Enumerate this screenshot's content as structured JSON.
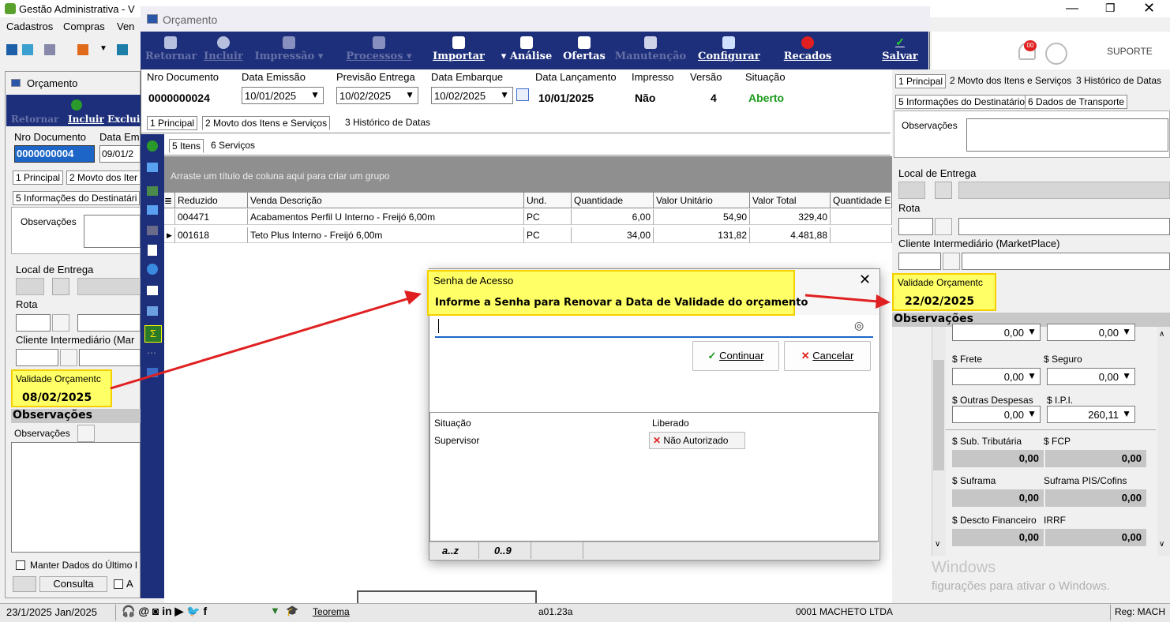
{
  "window": {
    "title": "Gestão Administrativa - V",
    "menu": [
      "Cadastros",
      "Compras",
      "Ven"
    ],
    "support_label": "SUPORTE",
    "notif_count": "00"
  },
  "left_panel": {
    "window_title": "Orçamento",
    "toolbar": {
      "retornar": "Retornar",
      "incluir": "Incluir",
      "excluir": "Exclui"
    },
    "nro_label": "Nro Documento",
    "data_label": "Data Em",
    "nro_value": "0000000004",
    "data_value": "09/01/2",
    "tabs": [
      "1 Principal",
      "2 Movto dos Iter"
    ],
    "tab2": "5 Informações do Destinatári",
    "observacoes_label": "Observações",
    "local_entrega": "Local de Entrega",
    "rota": "Rota",
    "cliente_intermediario": "Cliente Intermediário (Mar",
    "validade_label": "Validade Orçamentc",
    "validade_value": "08/02/2025",
    "observacoes_header": "Observações",
    "observacoes2_label": "Observações",
    "manter_dados": "Manter Dados do Último I",
    "consulta": "Consulta",
    "a_label": "A"
  },
  "inner": {
    "window_title": "Orçamento",
    "toolbar": {
      "retornar": "Retornar",
      "incluir": "Incluir",
      "impressao": "Impressão",
      "processos": "Processos",
      "importar": "Importar",
      "analise": "Análise",
      "ofertas": "Ofertas",
      "manutencao": "Manutenção",
      "configurar": "Configurar",
      "recados": "Recados",
      "salvar": "Salvar"
    },
    "header": {
      "nro_label": "Nro Documento",
      "nro_value": "0000000024",
      "emissao_label": "Data Emissão",
      "emissao_value": "10/01/2025",
      "previsao_label": "Previsão Entrega",
      "previsao_value": "10/02/2025",
      "embarque_label": "Data Embarque",
      "embarque_value": "10/02/2025",
      "lancamento_label": "Data Lançamento",
      "lancamento_value": "10/01/2025",
      "impresso_label": "Impresso",
      "impresso_value": "Não",
      "versao_label": "Versão",
      "versao_value": "4",
      "situacao_label": "Situação",
      "situacao_value": "Aberto"
    },
    "tabs": [
      "1 Principal",
      "2 Movto dos Itens e Serviços",
      "3 Histórico de Datas"
    ],
    "subtabs": [
      "5 Itens",
      "6 Serviços"
    ],
    "group_hint": "Arraste um título de coluna aqui para criar um grupo",
    "columns": [
      "Reduzido",
      "Venda Descrição",
      "Und.",
      "Quantidade",
      "Valor Unitário",
      "Valor Total",
      "Quantidade E"
    ],
    "rows": [
      [
        "004471",
        "Acabamentos Perfil U Interno - Freijó 6,00m",
        "PC",
        "6,00",
        "54,90",
        "329,40"
      ],
      [
        "001618",
        "Teto Plus Interno - Freijó 6,00m",
        "PC",
        "34,00",
        "131,82",
        "4.481,88"
      ]
    ]
  },
  "dialog": {
    "title": "Senha de Acesso",
    "subtitle": "Informe a Senha para Renovar a Data de Validade do orçamento",
    "continuar": "Continuar",
    "cancelar": "Cancelar",
    "col_situacao": "Situação",
    "col_liberado": "Liberado",
    "row_role": "Supervisor",
    "row_status": "Não Autorizado",
    "footer": [
      "a..z",
      "0..9"
    ]
  },
  "right_panel": {
    "tabs_row1": [
      "1 Principal",
      "2 Movto dos Itens e Serviços",
      "3 Histórico de Datas"
    ],
    "tabs_row2": [
      "5 Informações do Destinatário",
      "6 Dados de Transporte"
    ],
    "observacoes_label": "Observações",
    "local_entrega": "Local de Entrega",
    "rota": "Rota",
    "cliente_intermediario": "Cliente Intermediário (MarketPlace)",
    "validade_label": "Validade Orçamentc",
    "validade_value": "22/02/2025",
    "observacoes_header": "Observações",
    "top_values": [
      "0,00",
      "0,00"
    ],
    "frete": "$ Frete",
    "seguro": "$ Seguro",
    "frete_value": "0,00",
    "seguro_value": "0,00",
    "outras": "$ Outras Despesas",
    "ipi": "$ I.P.I.",
    "outras_value": "0,00",
    "ipi_value": "260,11",
    "sub_trib": "$ Sub. Tributária",
    "fcp": "$ FCP",
    "sub_trib_value": "0,00",
    "fcp_value": "0,00",
    "suframa": "$ Suframa",
    "suframa_pis": "Suframa PIS/Cofins",
    "suframa_value": "0,00",
    "suframa_pis_value": "0,00",
    "descto": "$ Descto Financeiro",
    "irrf": "IRRF",
    "descto_value": "0,00",
    "irrf_value": "0,00",
    "watermark1": "Windows",
    "watermark2": "figurações para ativar o Windows."
  },
  "statusbar": {
    "date": "23/1/2025 Jan/2025",
    "teorema": "Teorema",
    "version": "a01.23a",
    "company": "0001 MACHETO LTDA",
    "reg": "Reg: MACH"
  },
  "colors": {
    "toolbar": "#1d2f7a",
    "highlight": "#ffff66",
    "arrow": "#e02020",
    "situacao": "#1a9a1a"
  }
}
